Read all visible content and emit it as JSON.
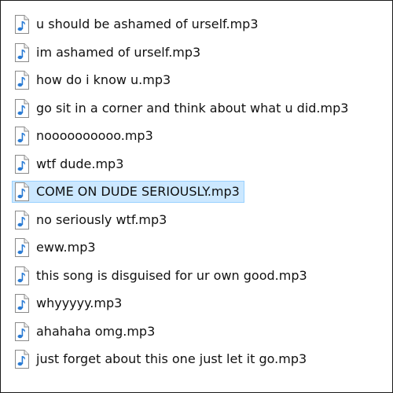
{
  "explorer": {
    "selected_index": 6,
    "colors": {
      "selection_fill": "#cce8ff",
      "selection_border": "#99d1ff",
      "note_blue": "#2a7bd4"
    },
    "files": [
      {
        "name": "u should be ashamed of urself.mp3",
        "icon": "audio-file-icon"
      },
      {
        "name": "im ashamed of urself.mp3",
        "icon": "audio-file-icon"
      },
      {
        "name": "how do i know u.mp3",
        "icon": "audio-file-icon"
      },
      {
        "name": "go sit in a corner and think about what u did.mp3",
        "icon": "audio-file-icon"
      },
      {
        "name": "noooooooooo.mp3",
        "icon": "audio-file-icon"
      },
      {
        "name": "wtf dude.mp3",
        "icon": "audio-file-icon"
      },
      {
        "name": "COME ON DUDE SERIOUSLY.mp3",
        "icon": "audio-file-icon"
      },
      {
        "name": "no seriously wtf.mp3",
        "icon": "audio-file-icon"
      },
      {
        "name": "eww.mp3",
        "icon": "audio-file-icon"
      },
      {
        "name": "this song is disguised for ur own good.mp3",
        "icon": "audio-file-icon"
      },
      {
        "name": "whyyyyy.mp3",
        "icon": "audio-file-icon"
      },
      {
        "name": "ahahaha omg.mp3",
        "icon": "audio-file-icon"
      },
      {
        "name": "just forget about this one just let it go.mp3",
        "icon": "audio-file-icon"
      }
    ]
  }
}
